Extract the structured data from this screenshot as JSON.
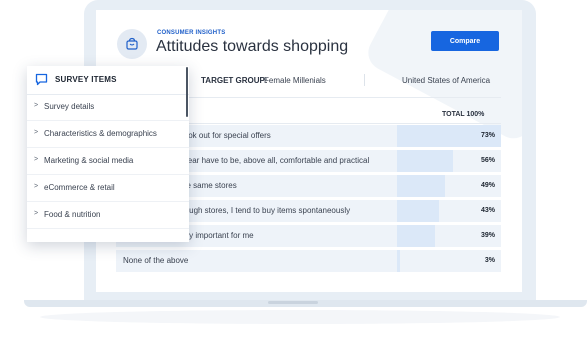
{
  "header": {
    "eyebrow": "CONSUMER INSIGHTS",
    "title": "Attitudes towards shopping",
    "compare_label": "Compare",
    "icon": "shopping-bag-icon"
  },
  "target_group": {
    "label": "TARGET GROUP:",
    "value": "Female Millenials",
    "country": "United States of America"
  },
  "table": {
    "total_label": "TOTAL 100%",
    "rows": [
      {
        "label": "look out for special offers",
        "value": "73%",
        "fill": 0.73
      },
      {
        "label": "wear have to be, above all, comfortable and practical",
        "value": "56%",
        "fill": 0.56
      },
      {
        "label": "he same stores",
        "value": "49%",
        "fill": 0.49
      },
      {
        "label": "rough stores, I tend to buy items spontaneously",
        "value": "43%",
        "fill": 0.43
      },
      {
        "label": "ery important for me",
        "value": "39%",
        "fill": 0.39
      },
      {
        "label": "None of the above",
        "value": "3%",
        "fill": 0.03
      }
    ]
  },
  "survey_panel": {
    "title": "SURVEY ITEMS",
    "icon": "chat-icon",
    "items": [
      {
        "label": "Survey details"
      },
      {
        "label": "Characteristics & demographics"
      },
      {
        "label": "Marketing & social media"
      },
      {
        "label": "eCommerce & retail"
      },
      {
        "label": "Food & nutrition"
      }
    ]
  },
  "colors": {
    "accent": "#1766e0",
    "bar_fill": "#dbe8f8",
    "row_bg": "#eef3f9",
    "laptop": "#e7eef5"
  }
}
